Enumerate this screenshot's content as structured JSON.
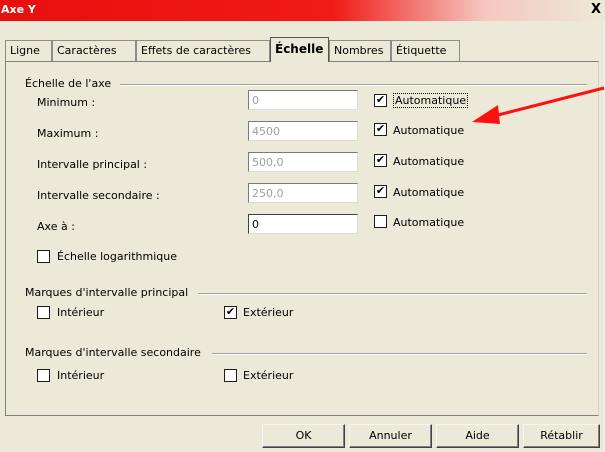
{
  "window": {
    "title": "Axe Y",
    "close_symbol": "X"
  },
  "tabs": [
    {
      "label": "Ligne"
    },
    {
      "label": "Caractères"
    },
    {
      "label": "Effets de caractères"
    },
    {
      "label": "Échelle",
      "active": true
    },
    {
      "label": "Nombres"
    },
    {
      "label": "Étiquette"
    }
  ],
  "scale": {
    "group_label": "Échelle de l'axe",
    "rows": [
      {
        "label": "Minimum :",
        "value": "0",
        "auto_label": "Automatique",
        "auto_checked": true,
        "enabled": false
      },
      {
        "label": "Maximum :",
        "value": "4500",
        "auto_label": "Automatique",
        "auto_checked": true,
        "enabled": false
      },
      {
        "label": "Intervalle principal :",
        "value": "500,0",
        "auto_label": "Automatique",
        "auto_checked": true,
        "enabled": false
      },
      {
        "label": "Intervalle secondaire :",
        "value": "250,0",
        "auto_label": "Automatique",
        "auto_checked": true,
        "enabled": false
      },
      {
        "label": "Axe à :",
        "value": "0",
        "auto_label": "Automatique",
        "auto_checked": false,
        "enabled": true
      }
    ],
    "log_label": "Échelle logarithmique",
    "log_checked": false
  },
  "major_marks": {
    "group_label": "Marques d'intervalle principal",
    "inner_label": "Intérieur",
    "inner_checked": false,
    "outer_label": "Extérieur",
    "outer_checked": true
  },
  "minor_marks": {
    "group_label": "Marques d'intervalle secondaire",
    "inner_label": "Intérieur",
    "inner_checked": false,
    "outer_label": "Extérieur",
    "outer_checked": false
  },
  "buttons": {
    "ok": "OK",
    "cancel": "Annuler",
    "help": "Aide",
    "reset": "Rétablir"
  },
  "colors": {
    "titlebar": "#e8100e",
    "dialog_bg": "#ece9d8",
    "annotation_arrow": "#ff0000"
  },
  "icons": {
    "checkmark": "✔",
    "close": "close-icon",
    "annotation": "red-arrow-annotation"
  }
}
